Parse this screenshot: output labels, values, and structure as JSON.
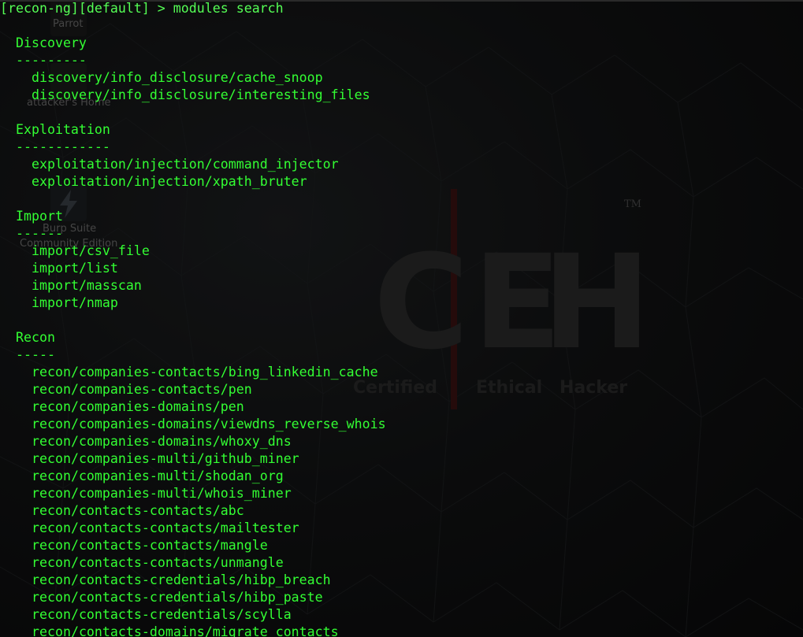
{
  "prompt": "[recon-ng][default] > modules search",
  "desktop": {
    "icons": [
      {
        "label": "Parrot",
        "icon": "parrot-icon"
      },
      {
        "label": "attacker's Home",
        "icon": "home-folder-icon"
      },
      {
        "label": "Burp Suite",
        "icon": "burp-suite-icon"
      },
      {
        "label": "Community Edition",
        "icon": "burp-suite-icon"
      }
    ],
    "logo": {
      "letters": [
        "C",
        "E",
        "H"
      ],
      "words": [
        "Certified",
        "Ethical",
        "Hacker"
      ],
      "tm": "TM"
    }
  },
  "sections": [
    {
      "name": "Discovery",
      "rule": "---------",
      "modules": [
        "discovery/info_disclosure/cache_snoop",
        "discovery/info_disclosure/interesting_files"
      ]
    },
    {
      "name": "Exploitation",
      "rule": "------------",
      "modules": [
        "exploitation/injection/command_injector",
        "exploitation/injection/xpath_bruter"
      ]
    },
    {
      "name": "Import",
      "rule": "------",
      "modules": [
        "import/csv_file",
        "import/list",
        "import/masscan",
        "import/nmap"
      ]
    },
    {
      "name": "Recon",
      "rule": "-----",
      "modules": [
        "recon/companies-contacts/bing_linkedin_cache",
        "recon/companies-contacts/pen",
        "recon/companies-domains/pen",
        "recon/companies-domains/viewdns_reverse_whois",
        "recon/companies-domains/whoxy_dns",
        "recon/companies-multi/github_miner",
        "recon/companies-multi/shodan_org",
        "recon/companies-multi/whois_miner",
        "recon/contacts-contacts/abc",
        "recon/contacts-contacts/mailtester",
        "recon/contacts-contacts/mangle",
        "recon/contacts-contacts/unmangle",
        "recon/contacts-credentials/hibp_breach",
        "recon/contacts-credentials/hibp_paste",
        "recon/contacts-credentials/scylla",
        "recon/contacts-domains/migrate_contacts"
      ]
    }
  ],
  "colors": {
    "terminal_text": "#33ff33",
    "background": "#0c0d0e"
  }
}
